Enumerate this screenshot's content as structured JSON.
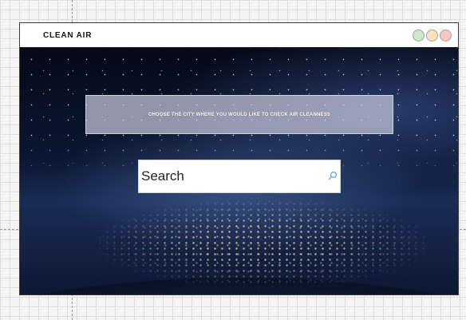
{
  "app": {
    "title": "CLEAN AIR"
  },
  "window_controls": [
    {
      "name": "green",
      "color": "#cde8c7"
    },
    {
      "name": "yellow",
      "color": "#f8e3b9"
    },
    {
      "name": "red",
      "color": "#f9c6c6"
    }
  ],
  "hero": {
    "banner_text": "CHOOSE THE CITY WHERE YOU WOULD LIKE TO CHECK AIR CLEANNESS"
  },
  "search": {
    "placeholder": "Search",
    "value": "",
    "icon": "search-icon"
  }
}
